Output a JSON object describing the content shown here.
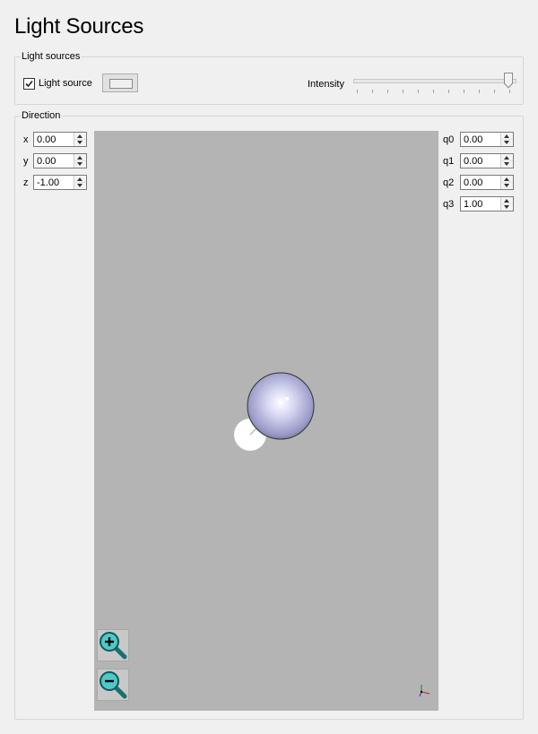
{
  "page": {
    "title": "Light Sources"
  },
  "light_sources": {
    "group_label": "Light sources",
    "checkbox_label": "Light source",
    "checkbox_checked": true,
    "intensity_label": "Intensity",
    "intensity_value": 1.0
  },
  "direction": {
    "group_label": "Direction",
    "vector": [
      {
        "label": "x",
        "value": "0.00"
      },
      {
        "label": "y",
        "value": "0.00"
      },
      {
        "label": "z",
        "value": "-1.00"
      }
    ],
    "quaternion": [
      {
        "label": "q0",
        "value": "0.00"
      },
      {
        "label": "q1",
        "value": "0.00"
      },
      {
        "label": "q2",
        "value": "0.00"
      },
      {
        "label": "q3",
        "value": "1.00"
      }
    ]
  },
  "viewport": {
    "background": "#b4b4b4",
    "sphere_color": "#b8b8e0",
    "light_color": "#ffffff",
    "icons": [
      "zoom-in-icon",
      "zoom-out-icon",
      "axis-triad-icon"
    ]
  }
}
